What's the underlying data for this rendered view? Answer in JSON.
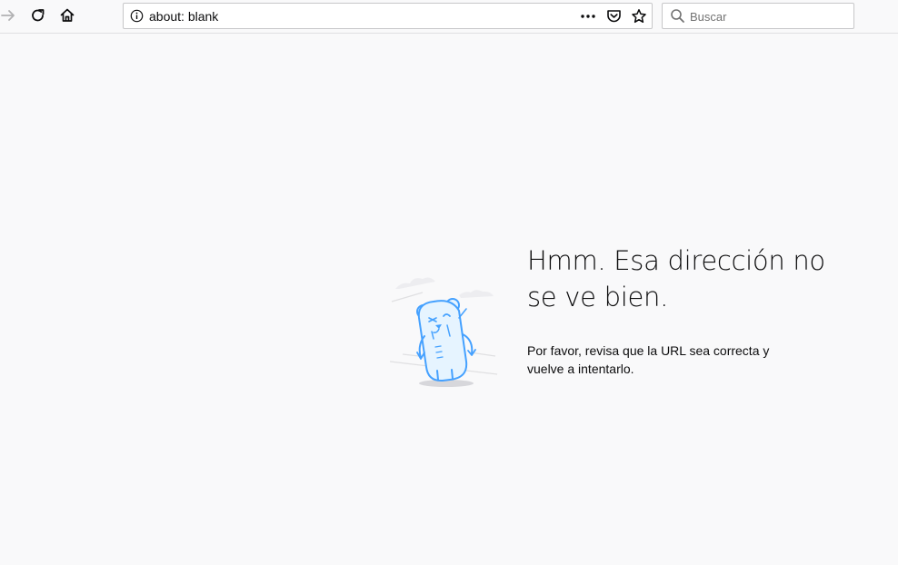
{
  "browser": {
    "url": "about: blank",
    "search_placeholder": "Buscar"
  },
  "toolbar": {
    "icons": [
      "forward-arrow-icon",
      "reload-icon",
      "home-icon"
    ],
    "url_actions": [
      "page-actions-icon",
      "pocket-icon",
      "bookmark-star-icon"
    ]
  },
  "error_page": {
    "title": "Hmm. Esa dirección no se ve bien.",
    "description": "Por favor, revisa que la URL sea correcta y vuelve a intentarlo."
  },
  "colors": {
    "background": "#f9f9fa",
    "text": "#0c0c0d",
    "illustration_blue": "#45a1ff",
    "illustration_fill": "#e6f4ff"
  }
}
